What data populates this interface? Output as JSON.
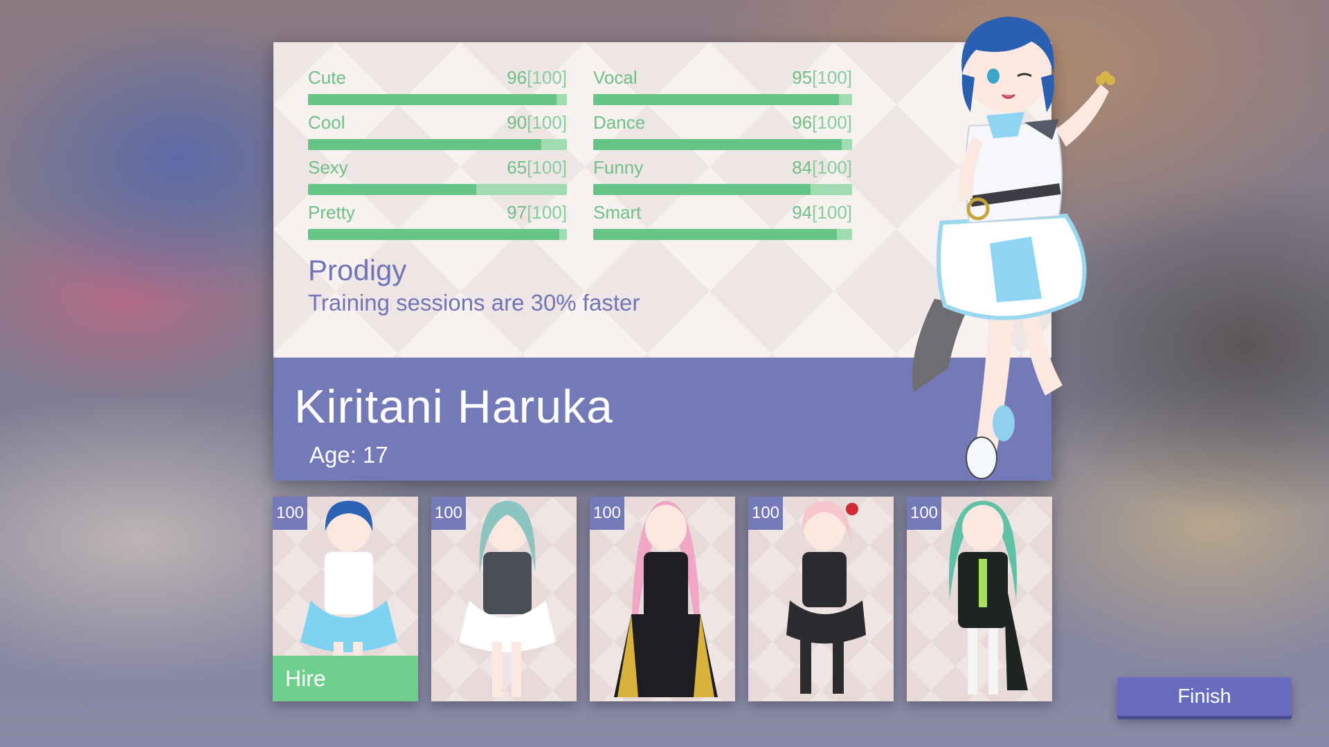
{
  "stats": [
    {
      "label": "Cute",
      "value": "96",
      "max": "[100]",
      "fraction": 0.96
    },
    {
      "label": "Vocal",
      "value": "95",
      "max": "[100]",
      "fraction": 0.95
    },
    {
      "label": "Cool",
      "value": "90",
      "max": "[100]",
      "fraction": 0.9
    },
    {
      "label": "Dance",
      "value": "96",
      "max": "[100]",
      "fraction": 0.96
    },
    {
      "label": "Sexy",
      "value": "65",
      "max": "[100]",
      "fraction": 0.65
    },
    {
      "label": "Funny",
      "value": "84",
      "max": "[100]",
      "fraction": 0.84
    },
    {
      "label": "Pretty",
      "value": "97",
      "max": "[100]",
      "fraction": 0.97
    },
    {
      "label": "Smart",
      "value": "94",
      "max": "[100]",
      "fraction": 0.94
    }
  ],
  "trait": {
    "name": "Prodigy",
    "description": "Training sessions are 30% faster"
  },
  "character": {
    "name": "Kiritani Haruka",
    "age": "Age: 17",
    "portrait_icon": "character-portrait"
  },
  "cards": [
    {
      "badge": "100",
      "hair": "#2a62b4",
      "outfit": "#ffffff",
      "accent": "#7fd2f0",
      "selected": true
    },
    {
      "badge": "100",
      "hair": "#8cc5bf",
      "outfit": "#4a4c56",
      "accent": "#ffffff",
      "selected": false
    },
    {
      "badge": "100",
      "hair": "#f0a6c4",
      "outfit": "#1e1e22",
      "accent": "#d8b23a",
      "selected": false
    },
    {
      "badge": "100",
      "hair": "#f5c6cc",
      "outfit": "#2b2b30",
      "accent": "#d02a34",
      "selected": false
    },
    {
      "badge": "100",
      "hair": "#5fc1a6",
      "outfit": "#1e2422",
      "accent": "#a6e05a",
      "selected": false
    }
  ],
  "hire_label": "Hire",
  "finish_label": "Finish",
  "colors": {
    "stat_green": "#6fbf87",
    "panel_purple": "#7479b8",
    "hire_green": "#6fcf8c",
    "finish_button": "#686cbf"
  }
}
